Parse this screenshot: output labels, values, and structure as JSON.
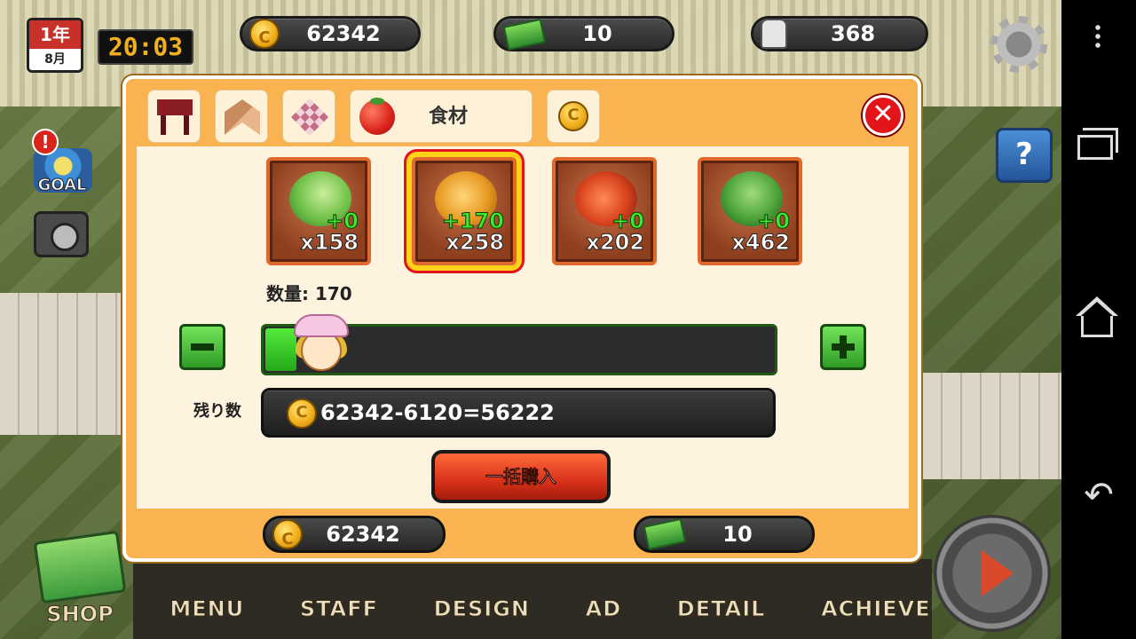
{
  "hud": {
    "calendar_year_label": "1年",
    "calendar_month_label": "8月",
    "clock": "20:03",
    "coins": "62342",
    "cash": "10",
    "likes": "368",
    "goal_label": "GOAL",
    "goal_badge": "!"
  },
  "dialog": {
    "tabs": [
      {
        "icon": "table-icon"
      },
      {
        "icon": "wall-icon"
      },
      {
        "icon": "floor-tile-icon"
      },
      {
        "icon": "tomato-icon",
        "label": "食材"
      },
      {
        "icon": "coin-icon"
      }
    ],
    "items": [
      {
        "name": "cabbage-tomato",
        "bonus": "+0",
        "count": "x158",
        "selected": false
      },
      {
        "name": "chicken",
        "bonus": "+170",
        "count": "x258",
        "selected": true
      },
      {
        "name": "shrimp",
        "bonus": "+0",
        "count": "x202",
        "selected": false
      },
      {
        "name": "herb-garlic",
        "bonus": "+0",
        "count": "x462",
        "selected": false
      }
    ],
    "quantity_label": "数量: 170",
    "quantity_fraction": 0.06,
    "remaining_label": "残り数",
    "remaining_value": "62342-6120=56222",
    "buy_button": "一括購入",
    "footer_coins": "62342",
    "footer_cash": "10",
    "close_symbol": "✕"
  },
  "nav": {
    "shop": "SHOP",
    "items": [
      "MENU",
      "STAFF",
      "DESIGN",
      "AD",
      "DETAIL",
      "ACHIEVE"
    ]
  },
  "system_bar": {
    "back_symbol": "↶"
  }
}
